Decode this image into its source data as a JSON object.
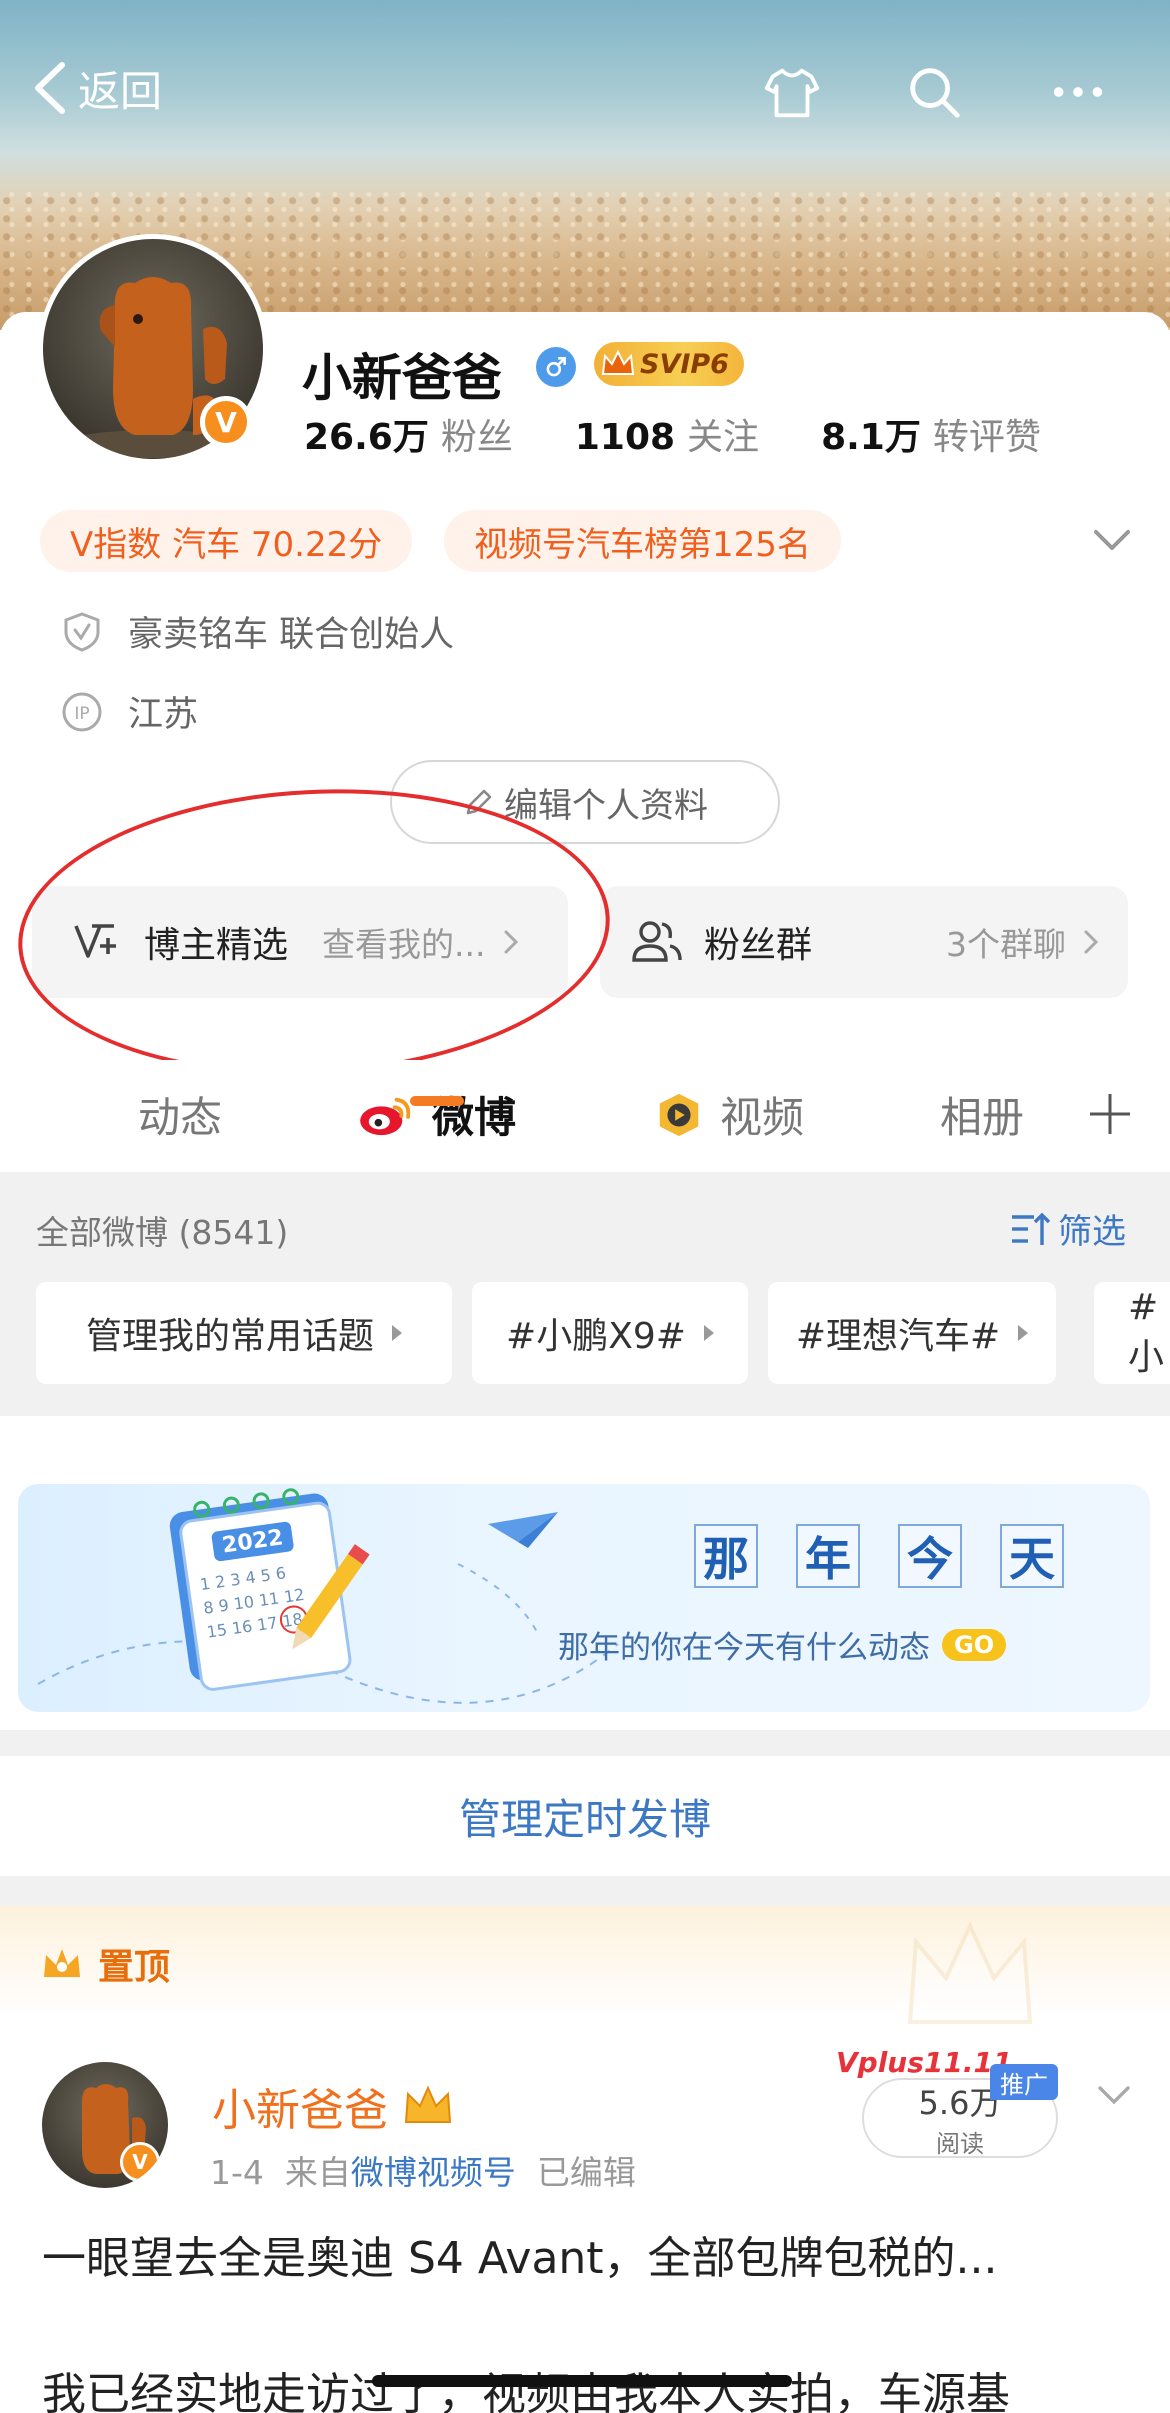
{
  "header": {
    "back_label": "返回"
  },
  "profile": {
    "name": "小新爸爸",
    "svip": "SVIP6",
    "stats": [
      {
        "value": "26.6万",
        "label": "粉丝"
      },
      {
        "value": "1108",
        "label": "关注"
      },
      {
        "value": "8.1万",
        "label": "转评赞"
      }
    ],
    "tags": [
      "V指数 汽车 70.22分",
      "视频号汽车榜第125名"
    ],
    "title": "豪卖铭车 联合创始人",
    "location": "江苏",
    "edit_label": "编辑个人资料"
  },
  "features": {
    "blogger_pick": {
      "label": "博主精选",
      "sub": "查看我的..."
    },
    "fans_group": {
      "label": "粉丝群",
      "sub": "3个群聊"
    }
  },
  "tabs": [
    "动态",
    "微博",
    "视频",
    "相册"
  ],
  "posts_header": {
    "all_label": "全部微博 (8541)",
    "filter_label": "筛选"
  },
  "topics": [
    "管理我的常用话题",
    "#小鹏X9#",
    "#理想汽车#",
    "#小"
  ],
  "banner": {
    "title_chars": [
      "那",
      "年",
      "今",
      "天"
    ],
    "subtitle": "那年的你在今天有什么动态",
    "go": "GO",
    "year": "2022"
  },
  "manage_label": "管理定时发博",
  "pinned_label": "置顶",
  "post": {
    "author": "小新爸爸",
    "date": "1-4",
    "from_prefix": "来自",
    "source": "微博视频号",
    "edited": "已编辑",
    "reads_value": "5.6万",
    "reads_label": "阅读",
    "ad_label": "推广",
    "vplus": "Vplus11.11",
    "line1": "一眼望去全是奥迪 S4 Avant，全部包牌包税的...",
    "line2": "我已经实地走访过了，视频由我本人实拍，车源基"
  },
  "colors": {
    "accent": "#f47b22",
    "link": "#3d78c4",
    "circle_annotation": "#e42d2d"
  }
}
